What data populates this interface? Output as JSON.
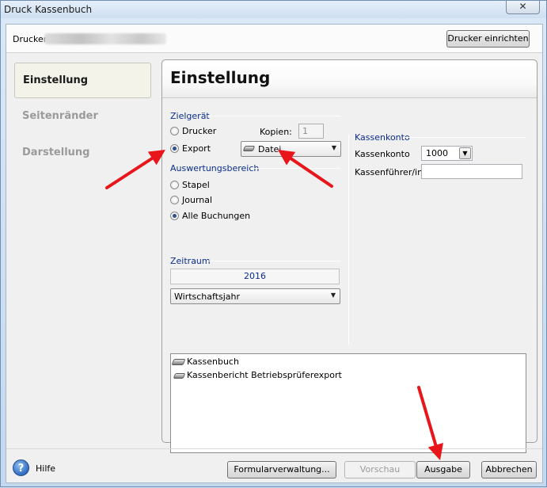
{
  "window": {
    "title": "Druck Kassenbuch",
    "close_glyph": "✕"
  },
  "printer_bar": {
    "label": "Drucker",
    "setup_button": "Drucker einrichten"
  },
  "nav": {
    "items": [
      {
        "label": "Einstellung",
        "active": true
      },
      {
        "label": "Seitenränder",
        "active": false
      },
      {
        "label": "Darstellung",
        "active": false
      }
    ]
  },
  "panel": {
    "title": "Einstellung",
    "zielgeraet": {
      "label": "Zielgerät",
      "options": [
        "Drucker",
        "Export"
      ],
      "selected": "Export",
      "copies_label": "Kopien:",
      "copies_value": "1",
      "export_target": "Datei"
    },
    "auswertungsbereich": {
      "label": "Auswertungsbereich",
      "options": [
        "Stapel",
        "Journal",
        "Alle Buchungen"
      ],
      "selected": "Alle Buchungen"
    },
    "zeitraum": {
      "label": "Zeitraum",
      "year": "2016",
      "period": "Wirtschaftsjahr"
    },
    "kassenkonto": {
      "label": "Kassenkonto",
      "account_label": "Kassenkonto",
      "account_value": "1000",
      "cashier_label": "Kassenführer/in",
      "cashier_value": ""
    },
    "list": {
      "items": [
        "Kassenbuch",
        "Kassenbericht Betriebsprüferexport"
      ]
    }
  },
  "footer": {
    "help_icon_glyph": "?",
    "help_label": "Hilfe",
    "forms_button": "Formularverwaltung...",
    "preview_button": "Vorschau",
    "output_button": "Ausgabe",
    "cancel_button": "Abbrechen"
  },
  "colors": {
    "annotation_arrow": "#e8161b",
    "group_label": "#0b2d8c"
  }
}
